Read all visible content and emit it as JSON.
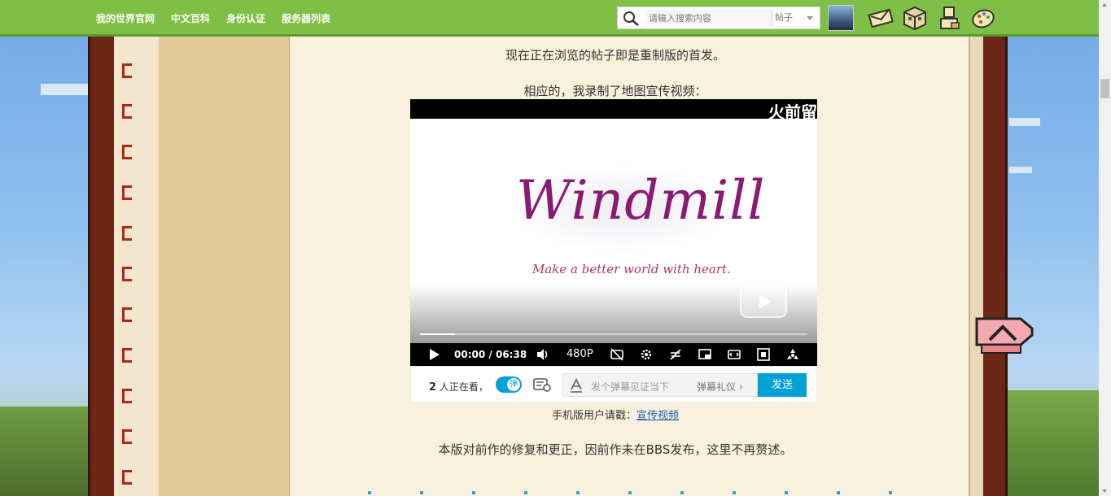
{
  "nav": {
    "items": [
      "我的世界官网",
      "中文百科",
      "身份认证",
      "服务器列表"
    ]
  },
  "search": {
    "placeholder": "请输入搜索内容",
    "type": "帖子"
  },
  "header_icons": [
    "envelope-icon",
    "crafting-table-icon",
    "user-icon",
    "palette-icon"
  ],
  "content": {
    "line1": "现在正在浏览的帖子即是重制版的首发。",
    "line2": "相应的，我录制了地图宣传视频：",
    "mobile_prefix": "手机版用户请戳：",
    "mobile_link": "宣传视频",
    "line3": "本版对前作的修复和更正，因前作未在BBS发布，这里不再赘述。"
  },
  "video": {
    "corner_text": "火前留",
    "logo_title": "Windmill",
    "logo_subtitle": "Make a better world with heart.",
    "current_time": "00:00",
    "separator": "/",
    "duration": "06:38",
    "quality": "480P",
    "progress": 0.09
  },
  "danmaku": {
    "watching_count": "2",
    "watching_suffix": "人正在看，",
    "toggle_label": "弹",
    "placeholder": "发个弹幕见证当下",
    "etiquette": "弹幕礼仪",
    "send_label": "发送"
  },
  "colors": {
    "topbar": "#7fbf45",
    "spine": "#6b2616",
    "paper": "#faf1dc",
    "accent": "#00a1d6"
  }
}
